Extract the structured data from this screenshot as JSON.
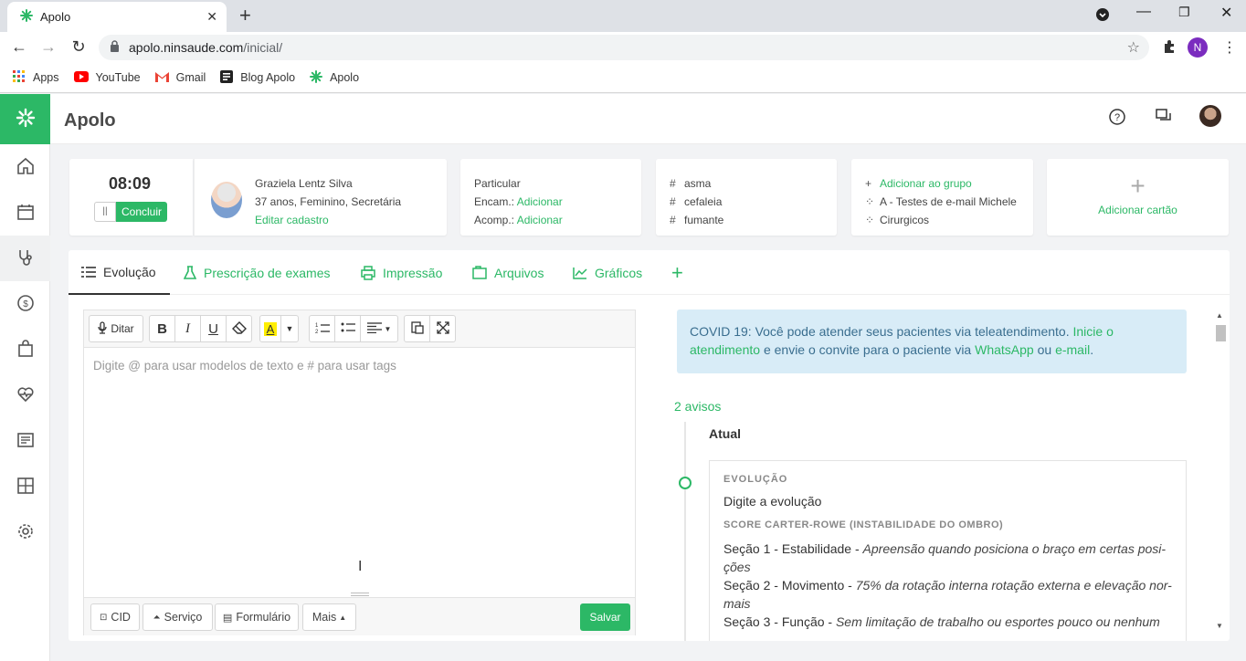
{
  "browser": {
    "tab_title": "Apolo",
    "url_host": "apolo.ninsaude.com",
    "url_path": "/inicial/",
    "profile_initial": "N",
    "bookmarks": [
      {
        "label": "Apps",
        "icon": "apps-grid-icon"
      },
      {
        "label": "YouTube",
        "icon": "youtube-icon"
      },
      {
        "label": "Gmail",
        "icon": "gmail-icon"
      },
      {
        "label": "Blog Apolo",
        "icon": "blog-icon"
      },
      {
        "label": "Apolo",
        "icon": "apolo-icon"
      }
    ]
  },
  "app": {
    "title": "Apolo",
    "accent_color": "#2cb866",
    "sidebar_icons": [
      "home-icon",
      "calendar-icon",
      "stethoscope-icon",
      "dollar-icon",
      "bag-icon",
      "heart-pulse-icon",
      "list-icon",
      "dashboard-icon",
      "gear-icon"
    ]
  },
  "timer_card": {
    "time": "08:09",
    "pause_label": "||",
    "conclude_label": "Concluir"
  },
  "patient_card": {
    "name": "Graziela Lentz Silva",
    "details": "37 anos, Feminino, Secretária",
    "edit_link": "Editar cadastro"
  },
  "insurance_card": {
    "type": "Particular",
    "encam_label": "Encam.:",
    "encam_link": "Adicionar",
    "acomp_label": "Acomp.:",
    "acomp_link": "Adicionar"
  },
  "tags_card": {
    "tags": [
      "asma",
      "cefaleia",
      "fumante"
    ]
  },
  "groups_card": {
    "add_label": "Adicionar ao grupo",
    "groups": [
      "A - Testes de e-mail Michele",
      "Cirurgicos"
    ]
  },
  "add_card": {
    "label": "Adicionar cartão"
  },
  "tabs": [
    {
      "label": "Evolução",
      "icon": "list-icon"
    },
    {
      "label": "Prescrição de exames",
      "icon": "flask-icon"
    },
    {
      "label": "Impressão",
      "icon": "printer-icon"
    },
    {
      "label": "Arquivos",
      "icon": "folder-icon"
    },
    {
      "label": "Gráficos",
      "icon": "chart-icon"
    }
  ],
  "editor": {
    "dictate_label": "Ditar",
    "placeholder": "Digite @ para usar modelos de texto e # para usar tags",
    "footer": {
      "cid": "CID",
      "servico": "Serviço",
      "formulario": "Formulário",
      "mais": "Mais",
      "salvar": "Salvar"
    }
  },
  "covid_banner": {
    "text1": "COVID 19: Você pode atender seus pacientes via teleatendimento. ",
    "link1": "Inicie o atendimento",
    "text2": " e envie o convite para o paciente via ",
    "link2": "WhatsApp",
    "text3": " ou ",
    "link3": "e-mail",
    "text4": "."
  },
  "timeline": {
    "avisos": "2 avisos",
    "current_label": "Atual",
    "evolucao_label": "EVOLUÇÃO",
    "evolucao_text": "Digite a evolução",
    "score_label": "SCORE CARTER-ROWE (INSTABILIDADE DO OMBRO)",
    "score_items": [
      {
        "section": "Seção 1 - Estabilidade - ",
        "value": "Apreensão quando posiciona o braço em certas posi-"
      },
      {
        "section": "",
        "value": "ções"
      },
      {
        "section": "Seção 2 - Movimento - ",
        "value": "75% da rotação interna rotação externa e elevação nor-"
      },
      {
        "section": "",
        "value": "mais"
      },
      {
        "section": "Seção 3 - Função - ",
        "value": "Sem limitação de trabalho ou esportes pouco ou nenhum"
      }
    ]
  }
}
